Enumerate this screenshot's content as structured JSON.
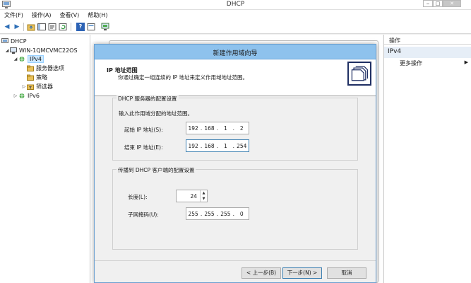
{
  "app": {
    "title": "DHCP"
  },
  "window_controls": {
    "minimize": "‒",
    "maximize": "□",
    "close": "✕"
  },
  "menu": [
    "文件(F)",
    "操作(A)",
    "查看(V)",
    "帮助(H)"
  ],
  "toolbar": {
    "back": "◀",
    "forward": "▶",
    "help": "?"
  },
  "tree": {
    "root": "DHCP",
    "server": "WIN-1QMCVMC22OS",
    "ipv4": "IPv4",
    "server_options": "服务器选项",
    "policies": "策略",
    "filters": "筛选器",
    "ipv6": "IPv6"
  },
  "actions": {
    "header": "操作",
    "section": "IPv4",
    "more": "更多操作",
    "more_arrow": "▶"
  },
  "dialog": {
    "title": "新建作用域向导",
    "header_title": "IP 地址范围",
    "header_desc": "你通过确定一组连续的 IP 地址来定义作用域地址范围。",
    "server_group": {
      "legend": "DHCP 服务器的配置设置",
      "prompt": "输入此作用域分配的地址范围。",
      "start_label": "起始 IP 地址(S):",
      "start_ip": [
        "192",
        "168",
        "1",
        "2"
      ],
      "end_label": "结束 IP 地址(E):",
      "end_ip": [
        "192",
        "168",
        "1",
        "254"
      ]
    },
    "client_group": {
      "legend": "传播到 DHCP 客户端的配置设置",
      "length_label": "长度(L):",
      "length_value": "24",
      "mask_label": "子网掩码(U):",
      "mask": [
        "255",
        "255",
        "255",
        "0"
      ]
    },
    "buttons": {
      "back": "< 上一步(B)",
      "next": "下一步(N) >",
      "cancel": "取消"
    }
  }
}
